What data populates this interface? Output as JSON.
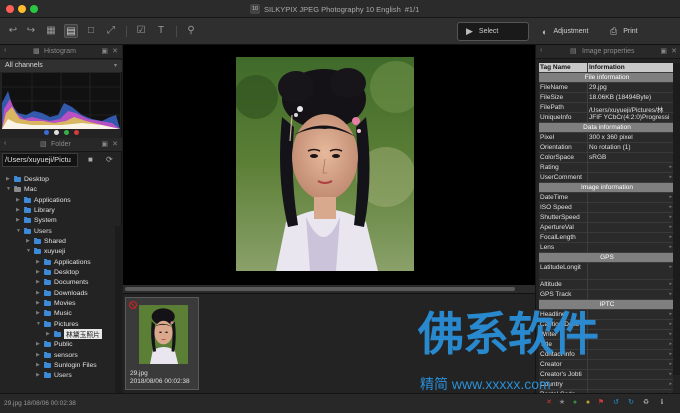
{
  "window": {
    "title": "SILKYPIX JPEG Photography 10 English",
    "counter": "#1/1",
    "logo": "10",
    "traffic_colors": [
      "#ff5f57",
      "#febc2e",
      "#28c840"
    ]
  },
  "toolbar": {
    "select_label": "Select",
    "adjustment_label": "Adjustment",
    "print_label": "Print"
  },
  "histogram_panel": {
    "title": "Histogram",
    "channel": "All channels"
  },
  "folder_panel": {
    "title": "Folder",
    "path": "/Users/xuyueji/Pictu",
    "tree": [
      {
        "label": "Desktop",
        "expanded": false
      },
      {
        "label": "Mac",
        "expanded": true
      },
      {
        "label": "Applications",
        "expanded": false
      },
      {
        "label": "Library",
        "expanded": false
      },
      {
        "label": "System",
        "expanded": false
      },
      {
        "label": "Users",
        "expanded": true
      },
      {
        "label": "Shared",
        "expanded": false
      },
      {
        "label": "xuyueji",
        "expanded": true
      },
      {
        "label": "Applications",
        "expanded": false
      },
      {
        "label": "Desktop",
        "expanded": false
      },
      {
        "label": "Documents",
        "expanded": false
      },
      {
        "label": "Downloads",
        "expanded": false
      },
      {
        "label": "Movies",
        "expanded": false
      },
      {
        "label": "Music",
        "expanded": false
      },
      {
        "label": "Pictures",
        "expanded": true
      },
      {
        "label": "林黛玉照片",
        "expanded": false,
        "selected": true
      },
      {
        "label": "Public",
        "expanded": false
      },
      {
        "label": "sensors",
        "expanded": false
      },
      {
        "label": "Sunlogin Files",
        "expanded": false
      },
      {
        "label": "Users",
        "expanded": false
      }
    ]
  },
  "thumbnail": {
    "name": "29.jpg",
    "date": "2018/08/06 00:02:38"
  },
  "properties_panel": {
    "title": "Image properties",
    "headers": [
      "Tag Name",
      "Information"
    ],
    "rows": [
      {
        "type": "section",
        "key": "File information"
      },
      {
        "key": "FileName",
        "value": "29.jpg"
      },
      {
        "key": "FileSize",
        "value": "18.06KB (18494Byte)"
      },
      {
        "key": "FilePath",
        "value": "/Users/xuyueji/Pictures/林"
      },
      {
        "key": "UniqueInfo",
        "value": "JFIF YCbCr(4:2:0)Progressi"
      },
      {
        "type": "section",
        "key": "Data information"
      },
      {
        "key": "Pixel",
        "value": "300 x 360 pixel"
      },
      {
        "key": "Orientation",
        "value": "No rotation (1)"
      },
      {
        "key": "ColorSpace",
        "value": "sRGB"
      },
      {
        "key": "Rating",
        "value": ""
      },
      {
        "key": "UserComment",
        "value": ""
      },
      {
        "type": "section",
        "key": "Image information"
      },
      {
        "key": "DateTime",
        "value": ""
      },
      {
        "key": "ISO Speed",
        "value": ""
      },
      {
        "key": "ShutterSpeed",
        "value": ""
      },
      {
        "key": "ApertureVal",
        "value": ""
      },
      {
        "key": "FocalLength",
        "value": ""
      },
      {
        "key": "Lens",
        "value": ""
      },
      {
        "type": "section",
        "key": "GPS"
      },
      {
        "key": "LatitudeLongit",
        "value": "",
        "tall": true
      },
      {
        "key": "Altitude",
        "value": ""
      },
      {
        "key": "GPS Track",
        "value": ""
      },
      {
        "type": "section",
        "key": "IPTC"
      },
      {
        "key": "Headline",
        "value": ""
      },
      {
        "key": "Caption/Desc",
        "value": ""
      },
      {
        "key": "Writer",
        "value": ""
      },
      {
        "key": "Title",
        "value": ""
      },
      {
        "key": "Contact info",
        "value": ""
      },
      {
        "key": "Creator",
        "value": ""
      },
      {
        "key": "Creator's Jobti",
        "value": ""
      },
      {
        "key": "Country",
        "value": ""
      },
      {
        "key": "Postal Code",
        "value": ""
      }
    ]
  },
  "status": {
    "text": "29.jpg 18/08/06 00:02:38"
  },
  "watermark": {
    "big": "佛系软件",
    "small": "精简 www.xxxxx.com"
  }
}
